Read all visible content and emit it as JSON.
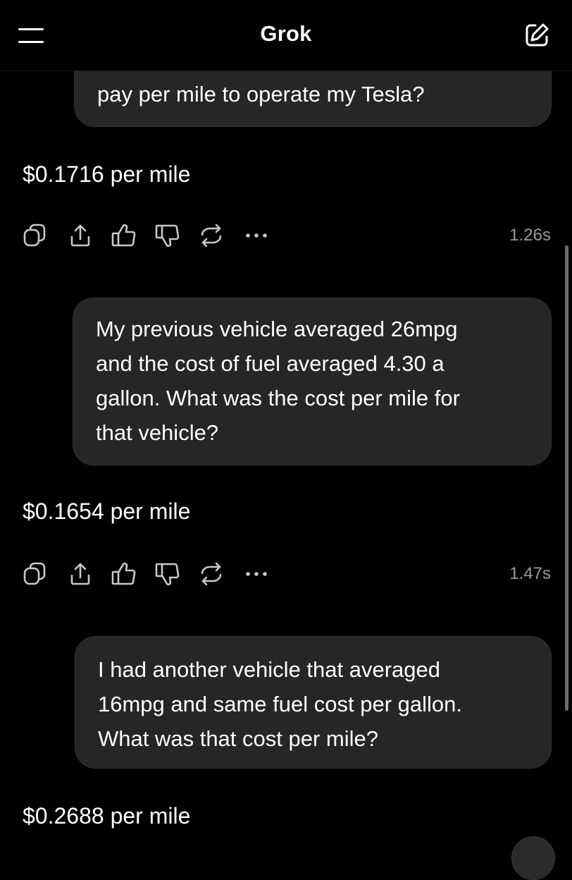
{
  "header": {
    "title": "Grok",
    "menu_icon": "hamburger-menu-icon",
    "new_chat_icon": "new-chat-edit-icon"
  },
  "messages": [
    {
      "role": "user",
      "text": "pay per mile to operate my Tesla?"
    },
    {
      "role": "assistant",
      "text": "$0.1716 per mile",
      "response_time": "1.26s"
    },
    {
      "role": "user",
      "lines": [
        "My previous vehicle averaged 26mpg",
        "and the cost of fuel averaged 4.30 a",
        "gallon. What was the cost per mile for",
        "that vehicle?"
      ]
    },
    {
      "role": "assistant",
      "text": "$0.1654 per mile",
      "response_time": "1.47s"
    },
    {
      "role": "user",
      "lines": [
        "I had another vehicle that averaged",
        "16mpg and same fuel cost per gallon.",
        "What was that cost per mile?"
      ]
    },
    {
      "role": "assistant",
      "text": "$0.2688 per mile"
    }
  ],
  "actions": [
    "copy-icon",
    "share-icon",
    "thumbs-up-icon",
    "thumbs-down-icon",
    "regenerate-icon",
    "more-options-icon"
  ],
  "colors": {
    "background": "#000000",
    "bubble": "#262626",
    "bubble_border": "#343434",
    "text": "#ffffff",
    "muted": "#9a9a9a"
  }
}
